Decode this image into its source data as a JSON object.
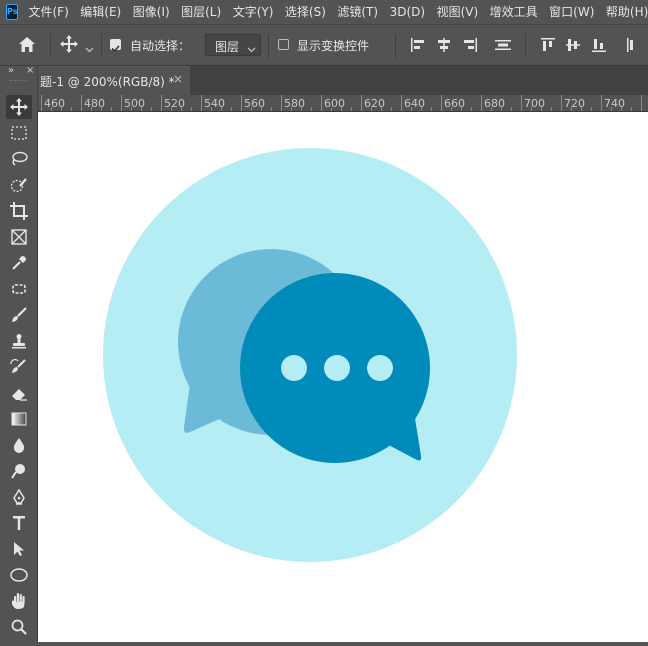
{
  "app": {
    "logo_text": "Ps",
    "accent_color": "#31a8ff"
  },
  "menu": {
    "items": [
      "文件(F)",
      "编辑(E)",
      "图像(I)",
      "图层(L)",
      "文字(Y)",
      "选择(S)",
      "滤镜(T)",
      "3D(D)",
      "视图(V)",
      "增效工具",
      "窗口(W)",
      "帮助(H)"
    ]
  },
  "options_bar": {
    "home_icon": "home-icon",
    "move_icon": "move-icon",
    "auto_select_label": "自动选择：",
    "auto_select_checked": true,
    "layer_dropdown_value": "图层",
    "show_transform_label": "显示变换控件",
    "show_transform_checked": false,
    "align_icons": [
      "align-left-icon",
      "align-center-h-icon",
      "align-right-icon",
      "distribute-h-icon",
      "align-top-icon",
      "align-center-v-icon",
      "align-bottom-icon",
      "align-more-icon"
    ]
  },
  "document_tab": {
    "title": "题-1 @ 200%(RGB/8) *",
    "close_glyph": "×"
  },
  "ruler": {
    "labels": [
      "460",
      "480",
      "500",
      "520",
      "540",
      "560",
      "580",
      "600",
      "620",
      "640",
      "660",
      "680",
      "700",
      "720",
      "740"
    ]
  },
  "toolbar": {
    "collapse_glyph": "»",
    "close_glyph": "×",
    "tools": [
      "move-tool",
      "marquee-tool",
      "lasso-tool",
      "quick-select-tool",
      "crop-tool",
      "frame-tool",
      "eyedropper-tool",
      "healing-tool",
      "brush-tool",
      "stamp-tool",
      "history-brush-tool",
      "eraser-tool",
      "gradient-tool",
      "blur-tool",
      "dodge-tool",
      "pen-tool",
      "type-tool",
      "path-select-tool",
      "ellipse-tool",
      "hand-tool",
      "zoom-tool"
    ],
    "active_tool": "move-tool"
  },
  "artwork": {
    "background_circle_color": "#b5edf4",
    "back_bubble_color": "#6bbad7",
    "front_bubble_color": "#008bbb",
    "dots_color": "#b5edf4"
  }
}
